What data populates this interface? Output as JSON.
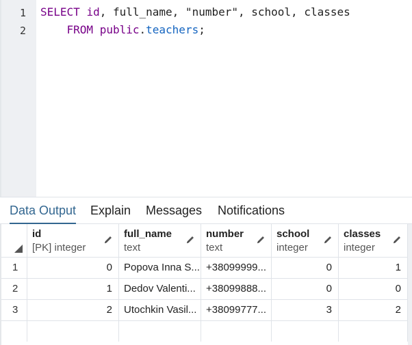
{
  "editor": {
    "lines": [
      {
        "number": "1",
        "tokens": [
          {
            "text": "SELECT",
            "type": "keyword"
          },
          {
            "text": " ",
            "type": "plain"
          },
          {
            "text": "id",
            "type": "keyword"
          },
          {
            "text": ", full_name, \"number\", school, classes",
            "type": "plain"
          }
        ]
      },
      {
        "number": "2",
        "tokens": [
          {
            "text": "    ",
            "type": "plain"
          },
          {
            "text": "FROM",
            "type": "keyword"
          },
          {
            "text": " ",
            "type": "plain"
          },
          {
            "text": "public",
            "type": "keyword"
          },
          {
            "text": ".",
            "type": "plain"
          },
          {
            "text": "teachers",
            "type": "identifier"
          },
          {
            "text": ";",
            "type": "plain"
          }
        ]
      }
    ]
  },
  "tabs": [
    {
      "label": "Data Output",
      "active": true
    },
    {
      "label": "Explain",
      "active": false
    },
    {
      "label": "Messages",
      "active": false
    },
    {
      "label": "Notifications",
      "active": false
    }
  ],
  "grid": {
    "columns": [
      {
        "name": "id",
        "type": "[PK] integer",
        "align": "right"
      },
      {
        "name": "full_name",
        "type": "text",
        "align": "left"
      },
      {
        "name": "number",
        "type": "text",
        "align": "left"
      },
      {
        "name": "school",
        "type": "integer",
        "align": "right"
      },
      {
        "name": "classes",
        "type": "integer",
        "align": "right"
      }
    ],
    "rows": [
      {
        "rownum": "1",
        "cells": [
          "0",
          "Popova Inna S...",
          "+38099999...",
          "0",
          "1"
        ]
      },
      {
        "rownum": "2",
        "cells": [
          "1",
          "Dedov Valenti...",
          "+38099888...",
          "0",
          "0"
        ]
      },
      {
        "rownum": "3",
        "cells": [
          "2",
          "Utochkin Vasil...",
          "+38099777...",
          "3",
          "2"
        ]
      }
    ]
  },
  "colors": {
    "keyword": "#770088",
    "identifier": "#1565c0",
    "active_tab": "#326690",
    "gutter": "#eef0f3"
  },
  "icons": {
    "edit_column": "pencil-icon",
    "select_all": "corner-triangle-icon"
  }
}
